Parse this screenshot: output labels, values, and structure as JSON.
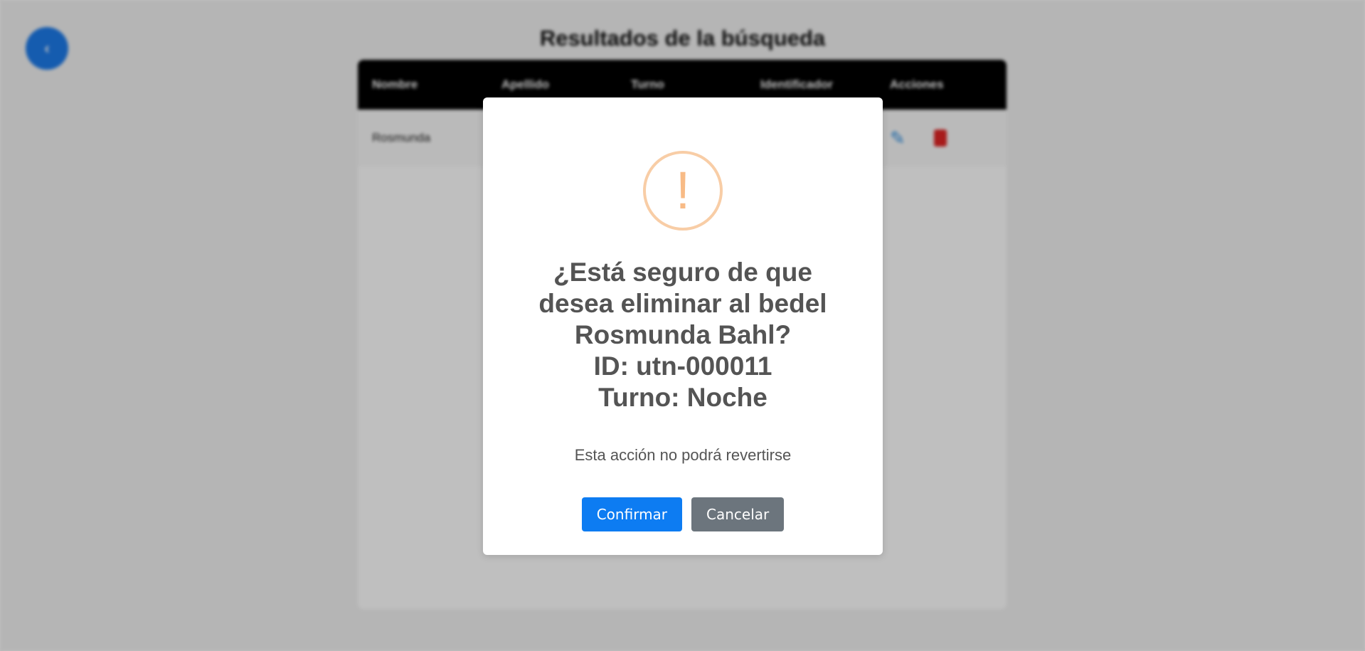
{
  "background": {
    "back_button_icon": "chevron-left-icon",
    "back_button_glyph": "‹",
    "page_title": "Resultados de la búsqueda",
    "table_headers": [
      "Nombre",
      "Apellido",
      "Turno",
      "Identificador",
      "Acciones"
    ],
    "rows": [
      {
        "nombre": "Rosmunda"
      }
    ]
  },
  "dialog": {
    "icon": "warning-icon",
    "icon_glyph": "!",
    "title_lines": [
      "¿Está seguro de que",
      "desea eliminar al bedel",
      "Rosmunda Bahl?",
      "ID: utn-000011",
      "Turno: Noche"
    ],
    "text": "Esta acción no podrá revertirse",
    "confirm_label": "Confirmar",
    "cancel_label": "Cancelar"
  },
  "colors": {
    "confirm": "#0d7cf2",
    "cancel": "#6c757d",
    "warning": "#f8bb86",
    "back_button": "#1d7bea"
  }
}
